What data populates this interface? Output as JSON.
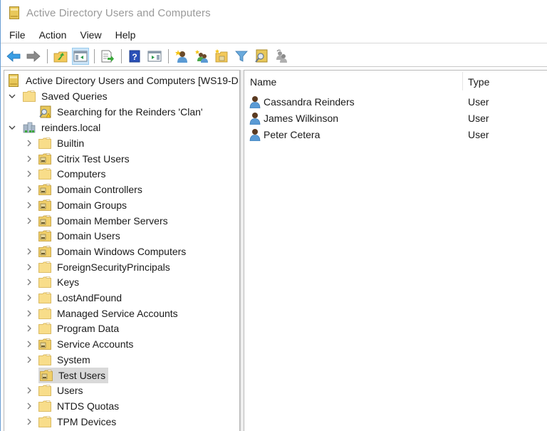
{
  "window": {
    "title": "Active Directory Users and Computers"
  },
  "menubar": {
    "items": [
      "File",
      "Action",
      "View",
      "Help"
    ]
  },
  "toolbar": {
    "buttons": [
      {
        "icon": "back-arrow-icon",
        "enabled": true
      },
      {
        "icon": "forward-arrow-icon",
        "enabled": false
      },
      {
        "icon": "up-one-level-icon",
        "enabled": true
      },
      {
        "icon": "show-hide-console-tree-icon",
        "enabled": true,
        "active": true
      },
      {
        "icon": "export-list-icon",
        "enabled": true
      },
      {
        "icon": "help-icon",
        "enabled": true
      },
      {
        "icon": "show-hide-action-pane-icon",
        "enabled": true
      },
      {
        "icon": "new-user-icon",
        "enabled": true
      },
      {
        "icon": "new-group-icon",
        "enabled": true
      },
      {
        "icon": "new-ou-icon",
        "enabled": true
      },
      {
        "icon": "filter-icon",
        "enabled": true
      },
      {
        "icon": "find-icon",
        "enabled": true
      },
      {
        "icon": "add-to-group-icon",
        "enabled": false
      }
    ]
  },
  "tree": {
    "root": "Active Directory Users and Computers [WS19-D",
    "saved_queries": {
      "label": "Saved Queries",
      "expanded": true,
      "children": [
        "Searching for the Reinders 'Clan'"
      ]
    },
    "domain": {
      "label": "reinders.local",
      "expanded": true,
      "children": [
        {
          "label": "Builtin",
          "type": "container",
          "has_children": true
        },
        {
          "label": "Citrix Test Users",
          "type": "ou",
          "has_children": true
        },
        {
          "label": "Computers",
          "type": "container",
          "has_children": true
        },
        {
          "label": "Domain Controllers",
          "type": "ou",
          "has_children": true
        },
        {
          "label": "Domain Groups",
          "type": "ou",
          "has_children": true
        },
        {
          "label": "Domain Member Servers",
          "type": "ou",
          "has_children": true
        },
        {
          "label": "Domain Users",
          "type": "ou",
          "has_children": false
        },
        {
          "label": "Domain Windows Computers",
          "type": "ou",
          "has_children": true
        },
        {
          "label": "ForeignSecurityPrincipals",
          "type": "container",
          "has_children": true
        },
        {
          "label": "Keys",
          "type": "container",
          "has_children": true
        },
        {
          "label": "LostAndFound",
          "type": "container",
          "has_children": true
        },
        {
          "label": "Managed Service Accounts",
          "type": "container",
          "has_children": true
        },
        {
          "label": "Program Data",
          "type": "container",
          "has_children": true
        },
        {
          "label": "Service Accounts",
          "type": "ou",
          "has_children": true
        },
        {
          "label": "System",
          "type": "container",
          "has_children": true
        },
        {
          "label": "Test Users",
          "type": "ou",
          "has_children": false,
          "selected": true
        },
        {
          "label": "Users",
          "type": "container",
          "has_children": true
        },
        {
          "label": "NTDS Quotas",
          "type": "container",
          "has_children": true
        },
        {
          "label": "TPM Devices",
          "type": "container",
          "has_children": true
        }
      ]
    }
  },
  "list": {
    "columns": [
      "Name",
      "Type"
    ],
    "rows": [
      {
        "name": "Cassandra Reinders",
        "type": "User"
      },
      {
        "name": "James Wilkinson",
        "type": "User"
      },
      {
        "name": "Peter Cetera",
        "type": "User"
      }
    ]
  },
  "colors": {
    "selection": "#d9d9d9",
    "folder": "#f6d77a",
    "accent": "#cce4f7"
  }
}
